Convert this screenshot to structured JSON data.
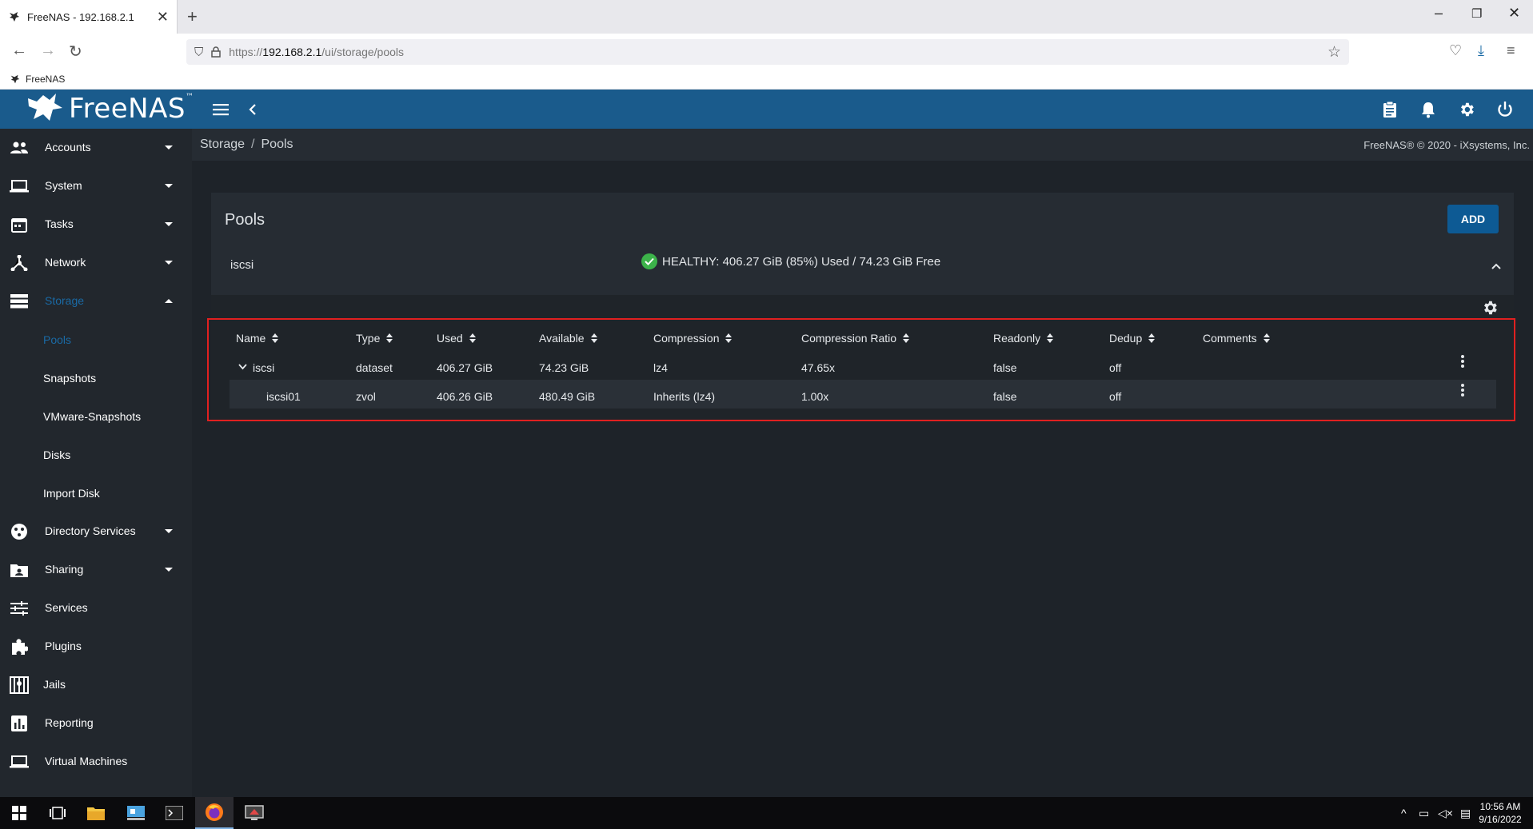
{
  "browser": {
    "tab_title": "FreeNAS - 192.168.2.1",
    "url_prefix": "https://",
    "url_host": "192.168.2.1",
    "url_path": "/ui/storage/pools",
    "bookmark": "FreeNAS"
  },
  "app": {
    "logo": "FreeNAS",
    "copyright": "FreeNAS® © 2020 - iXsystems, Inc.",
    "breadcrumb": [
      "Storage",
      "Pools"
    ],
    "accent": "#1a5b8c"
  },
  "sidebar": {
    "items": [
      {
        "label": "Accounts",
        "icon": "people-icon"
      },
      {
        "label": "System",
        "icon": "laptop-icon"
      },
      {
        "label": "Tasks",
        "icon": "calendar-icon"
      },
      {
        "label": "Network",
        "icon": "network-icon"
      },
      {
        "label": "Storage",
        "icon": "storage-icon"
      },
      {
        "label": "Directory Services",
        "icon": "directory-icon"
      },
      {
        "label": "Sharing",
        "icon": "folder-share-icon"
      },
      {
        "label": "Services",
        "icon": "sliders-icon"
      },
      {
        "label": "Plugins",
        "icon": "puzzle-icon"
      },
      {
        "label": "Jails",
        "icon": "jail-icon"
      },
      {
        "label": "Reporting",
        "icon": "chart-icon"
      },
      {
        "label": "Virtual Machines",
        "icon": "monitor-icon"
      }
    ],
    "storage_sub": [
      "Pools",
      "Snapshots",
      "VMware-Snapshots",
      "Disks",
      "Import Disk"
    ]
  },
  "pools": {
    "title": "Pools",
    "add_label": "ADD",
    "pool_name": "iscsi",
    "status": "HEALTHY: 406.27 GiB (85%) Used / 74.23 GiB Free",
    "columns": [
      "Name",
      "Type",
      "Used",
      "Available",
      "Compression",
      "Compression Ratio",
      "Readonly",
      "Dedup",
      "Comments"
    ],
    "rows": [
      {
        "name": "iscsi",
        "type": "dataset",
        "used": "406.27 GiB",
        "available": "74.23 GiB",
        "compression": "lz4",
        "ratio": "47.65x",
        "readonly": "false",
        "dedup": "off",
        "comments": ""
      },
      {
        "name": "iscsi01",
        "type": "zvol",
        "used": "406.26 GiB",
        "available": "480.49 GiB",
        "compression": "Inherits (lz4)",
        "ratio": "1.00x",
        "readonly": "false",
        "dedup": "off",
        "comments": ""
      }
    ]
  },
  "taskbar": {
    "time": "10:56 AM",
    "date": "9/16/2022"
  }
}
